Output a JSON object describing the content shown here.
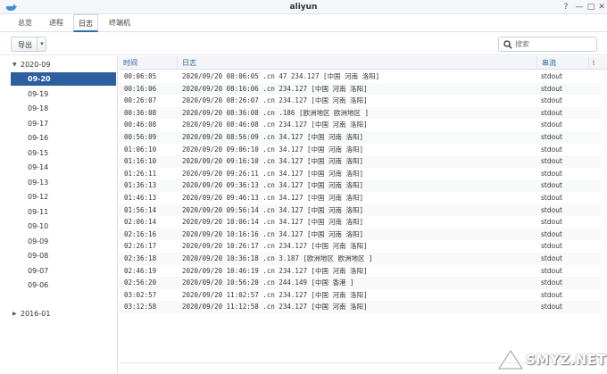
{
  "window": {
    "title": "aliyun",
    "controls": [
      {
        "name": "help-icon",
        "glyph": "?"
      },
      {
        "name": "minimize-icon",
        "glyph": "—"
      },
      {
        "name": "maximize-icon",
        "glyph": "□"
      },
      {
        "name": "close-icon",
        "glyph": "✕"
      }
    ]
  },
  "tabs": [
    {
      "label": "总览",
      "active": false
    },
    {
      "label": "进程",
      "active": false
    },
    {
      "label": "日志",
      "active": true
    },
    {
      "label": "终端机",
      "active": false
    }
  ],
  "toolbar": {
    "export_label": "导出",
    "export_caret": "▾",
    "search_placeholder": "搜索"
  },
  "sidebar": {
    "years": [
      {
        "label": "2020-09",
        "expanded": true,
        "caret": "▼"
      },
      {
        "label": "2016-01",
        "expanded": false,
        "caret": "▶"
      }
    ],
    "days": [
      {
        "label": "09-20",
        "selected": true
      },
      {
        "label": "09-19",
        "selected": false
      },
      {
        "label": "09-18",
        "selected": false
      },
      {
        "label": "09-17",
        "selected": false
      },
      {
        "label": "09-16",
        "selected": false
      },
      {
        "label": "09-15",
        "selected": false
      },
      {
        "label": "09-14",
        "selected": false
      },
      {
        "label": "09-13",
        "selected": false
      },
      {
        "label": "09-12",
        "selected": false
      },
      {
        "label": "09-11",
        "selected": false
      },
      {
        "label": "09-10",
        "selected": false
      },
      {
        "label": "09-09",
        "selected": false
      },
      {
        "label": "09-08",
        "selected": false
      },
      {
        "label": "09-07",
        "selected": false
      },
      {
        "label": "09-06",
        "selected": false
      }
    ]
  },
  "table": {
    "columns": [
      "时间",
      "日志",
      "串流"
    ],
    "column_menu": "⁞",
    "rows": [
      {
        "time": "00:06:05",
        "log": "2020/09/20 08:06:05         .cn 47        234.127 [中国 河南 洛阳]",
        "source": "stdout"
      },
      {
        "time": "00:16:06",
        "log": "2020/09/20 08:16:06         .cn           234.127 [中国 河南 洛阳]",
        "source": "stdout"
      },
      {
        "time": "00:26:07",
        "log": "2020/09/20 08:26:07         .cn           234.127 [中国 河南 洛阳]",
        "source": "stdout"
      },
      {
        "time": "00:36:08",
        "log": "2020/09/20 08:36:08         .cn           .186 [欧洲地区 欧洲地区 ]",
        "source": "stdout"
      },
      {
        "time": "00:46:08",
        "log": "2020/09/20 08:46:08         .cn           234.127 [中国 河南 洛阳]",
        "source": "stdout"
      },
      {
        "time": "00:56:09",
        "log": "2020/09/20 08:56:09         .cn           34.127 [中国 河南 洛阳]",
        "source": "stdout"
      },
      {
        "time": "01:06:10",
        "log": "2020/09/20 09:06:10         .cn           34.127 [中国 河南 洛阳]",
        "source": "stdout"
      },
      {
        "time": "01:16:10",
        "log": "2020/09/20 09:16:10         .cn           34.127 [中国 河南 洛阳]",
        "source": "stdout"
      },
      {
        "time": "01:26:11",
        "log": "2020/09/20 09:26:11         .cn           34.127 [中国 河南 洛阳]",
        "source": "stdout"
      },
      {
        "time": "01:36:13",
        "log": "2020/09/20 09:36:13         .cn           34.127 [中国 河南 洛阳]",
        "source": "stdout"
      },
      {
        "time": "01:46:13",
        "log": "2020/09/20 09:46:13         .cn           34.127 [中国 河南 洛阳]",
        "source": "stdout"
      },
      {
        "time": "01:56:14",
        "log": "2020/09/20 09:56:14         .cn           34.127 [中国 河南 洛阳]",
        "source": "stdout"
      },
      {
        "time": "02:06:14",
        "log": "2020/09/20 10:06:14         .cn           34.127 [中国 河南 洛阳]",
        "source": "stdout"
      },
      {
        "time": "02:16:16",
        "log": "2020/09/20 10:16:16         .cn           34.127 [中国 河南 洛阳]",
        "source": "stdout"
      },
      {
        "time": "02:26:17",
        "log": "2020/09/20 10:26:17         .cn           234.127 [中国 河南 洛阳]",
        "source": "stdout"
      },
      {
        "time": "02:36:18",
        "log": "2020/09/20 10:36:18         .cn           3.187 [欧洲地区 欧洲地区 ]",
        "source": "stdout"
      },
      {
        "time": "02:46:19",
        "log": "2020/09/20 10:46:19         .cn           234.127 [中国 河南 洛阳]",
        "source": "stdout"
      },
      {
        "time": "02:56:20",
        "log": "2020/09/20 10:56:20         .cn           244.149 [中国 香港 ]",
        "source": "stdout"
      },
      {
        "time": "03:02:57",
        "log": "2020/09/20 11:02:57         .cn           234.127 [中国 河南 洛阳]",
        "source": "stdout"
      },
      {
        "time": "03:12:58",
        "log": "2020/09/20 11:12:58         .cn           234.127 [中国 河南 洛阳]",
        "source": "stdout"
      }
    ]
  },
  "watermark": {
    "text": "SMYZ.NET"
  },
  "colors": {
    "accent": "#2c5f9e",
    "header_text": "#2a5d94"
  }
}
